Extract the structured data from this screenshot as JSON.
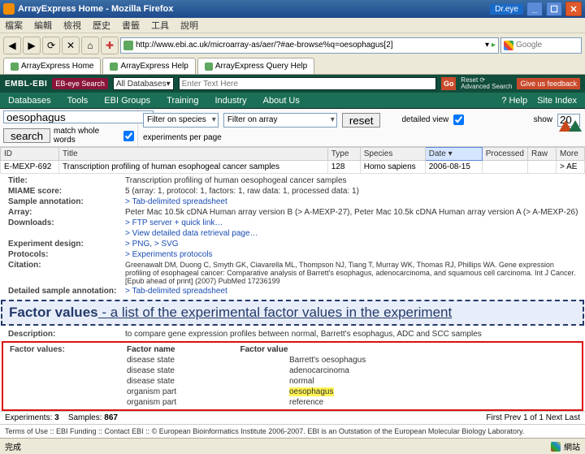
{
  "window": {
    "title": "ArrayExpress Home - Mozilla Firefox",
    "dreye": "Dr.eye"
  },
  "menu": {
    "file": "檔案",
    "edit": "編輯",
    "view": "檢視",
    "history": "歷史",
    "bookmarks": "書籤",
    "tools": "工具",
    "help": "說明"
  },
  "url": "http://www.ebi.ac.uk/microarray-as/aer/?#ae-browse%q=oesophagus[2]",
  "searchEngine": "Google",
  "tabs": [
    {
      "label": "ArrayExpress Home"
    },
    {
      "label": "ArrayExpress Help"
    },
    {
      "label": "ArrayExpress Query Help"
    }
  ],
  "embl": {
    "logo": "EMBL-EBI",
    "ebeye": "EB-eye Search",
    "db": "All Databases",
    "placeholder": "Enter Text Here",
    "go": "Go",
    "reset": "Reset ⟳",
    "adv": "Advanced Search",
    "feedback": "Give us feedback",
    "nav": {
      "db": "Databases",
      "tools": "Tools",
      "groups": "EBI Groups",
      "training": "Training",
      "industry": "Industry",
      "about": "About Us",
      "help": "Help",
      "site": "Site Index"
    }
  },
  "aeSearch": {
    "kw": "oesophagus",
    "searchBtn": "search",
    "matchWhole": "match whole words",
    "speciesLbl": "Filter on species",
    "arrayLbl": "Filter on array",
    "resetBtn": "reset",
    "detailed": "detailed view",
    "showLbl": "show",
    "perPage": "20",
    "perPageSuffix": "experiments per page"
  },
  "columns": {
    "id": "ID",
    "title": "Title",
    "type": "Type",
    "species": "Species",
    "date": "Date ▾",
    "processed": "Processed",
    "raw": "Raw",
    "more": "More"
  },
  "row": {
    "id": "E-MEXP-692",
    "title": "Transcription profiling of human esophogeal cancer samples",
    "type": "128",
    "species": "Homo sapiens",
    "date": "2006-08-15",
    "more": "> AE"
  },
  "detail": {
    "title_l": "Title:",
    "title_v": "Transcription profiling of human oesophogeal cancer samples",
    "miame_l": "MIAME score:",
    "miame_v": "5  (array: 1, protocol: 1, factors: 1, raw data: 1, processed data: 1)",
    "sample_l": "Sample annotation:",
    "sample_v": "> Tab-delimited spreadsheet",
    "array_l": "Array:",
    "array_v": "Peter Mac 10.5k cDNA Human array version B (> A-MEXP-27), Peter Mac 10.5k cDNA Human array version A (> A-MEXP-26)",
    "downloads_l": "Downloads:",
    "downloads_v1": "> FTP server + quick link…",
    "downloads_v2": "> View detailed data retrieval page…",
    "design_l": "Experiment design:",
    "design_v": "> PNG, > SVG",
    "protocols_l": "Protocols:",
    "protocols_v": "> Experiments protocols",
    "citation_l": "Citation:",
    "citation_v": "Greenawalt DM, Duong C, Smyth GK, Ciavarella ML, Thompson NJ, Tiang T, Murray WK, Thomas RJ, Phillips WA. Gene expression profiling of esophageal cancer: Comparative analysis of Barrett's esophagus, adenocarcinoma, and squamous cell carcinoma. Int J Cancer. [Epub ahead of print] (2007) PubMed 17236199",
    "dsa_l": "Detailed sample annotation:",
    "dsa_v": "> Tab-delimited spreadsheet",
    "desc_l": "Description:",
    "desc_v": "to compare gene expression profiles between normal, Barrett's esophagus, ADC and SCC samples"
  },
  "annotation": {
    "head": "Factor values",
    "rest": " - a list of the experimental factor values in the experiment"
  },
  "fv": {
    "label": "Factor values:",
    "col1": "Factor name",
    "col2": "Factor value",
    "rows": [
      {
        "name": "disease state",
        "value": "Barrett's oesophagus"
      },
      {
        "name": "disease state",
        "value": "adenocarcinoma"
      },
      {
        "name": "disease state",
        "value": "normal"
      },
      {
        "name": "organism part",
        "value": "oesophagus",
        "hl": true
      },
      {
        "name": "organism part",
        "value": "reference"
      }
    ]
  },
  "bottom": {
    "exp": "Experiments:",
    "expN": "3",
    "samp": "Samples:",
    "sampN": "867",
    "pager": "First  Prev   1   of   1   Next  Last"
  },
  "footer": "Terms of Use :: EBI Funding :: Contact EBI :: © European Bioinformatics Institute 2006-2007. EBI is an Outstation of the European Molecular Biology Laboratory.",
  "status": {
    "done": "完成",
    "zone": "網站"
  }
}
